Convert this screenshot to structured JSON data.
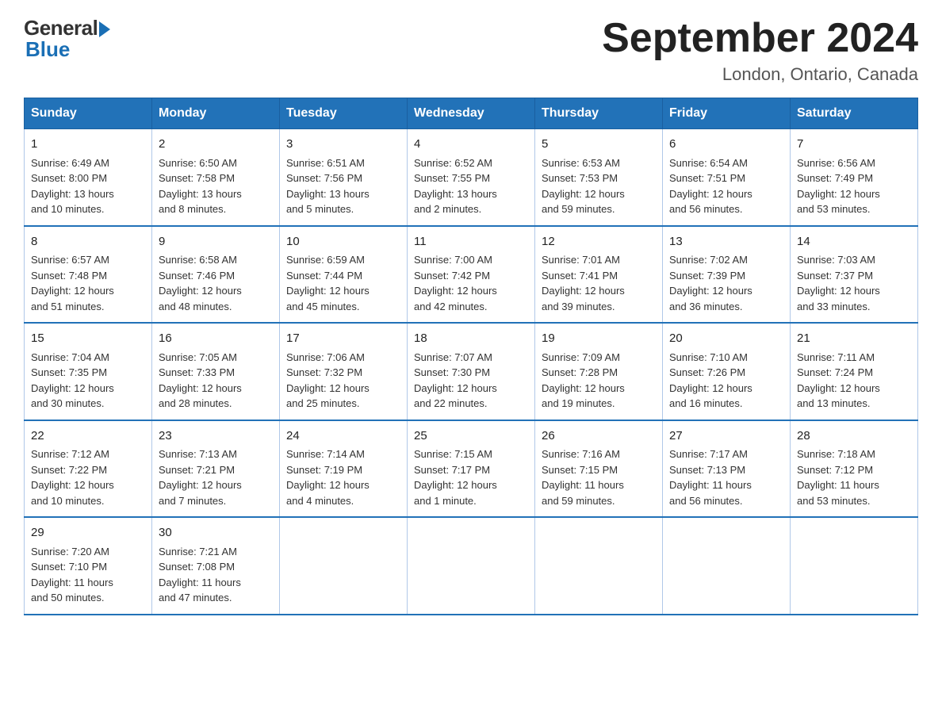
{
  "logo": {
    "general": "General",
    "blue": "Blue"
  },
  "calendar": {
    "title": "September 2024",
    "subtitle": "London, Ontario, Canada"
  },
  "headers": [
    "Sunday",
    "Monday",
    "Tuesday",
    "Wednesday",
    "Thursday",
    "Friday",
    "Saturday"
  ],
  "weeks": [
    [
      {
        "day": "1",
        "info": "Sunrise: 6:49 AM\nSunset: 8:00 PM\nDaylight: 13 hours\nand 10 minutes."
      },
      {
        "day": "2",
        "info": "Sunrise: 6:50 AM\nSunset: 7:58 PM\nDaylight: 13 hours\nand 8 minutes."
      },
      {
        "day": "3",
        "info": "Sunrise: 6:51 AM\nSunset: 7:56 PM\nDaylight: 13 hours\nand 5 minutes."
      },
      {
        "day": "4",
        "info": "Sunrise: 6:52 AM\nSunset: 7:55 PM\nDaylight: 13 hours\nand 2 minutes."
      },
      {
        "day": "5",
        "info": "Sunrise: 6:53 AM\nSunset: 7:53 PM\nDaylight: 12 hours\nand 59 minutes."
      },
      {
        "day": "6",
        "info": "Sunrise: 6:54 AM\nSunset: 7:51 PM\nDaylight: 12 hours\nand 56 minutes."
      },
      {
        "day": "7",
        "info": "Sunrise: 6:56 AM\nSunset: 7:49 PM\nDaylight: 12 hours\nand 53 minutes."
      }
    ],
    [
      {
        "day": "8",
        "info": "Sunrise: 6:57 AM\nSunset: 7:48 PM\nDaylight: 12 hours\nand 51 minutes."
      },
      {
        "day": "9",
        "info": "Sunrise: 6:58 AM\nSunset: 7:46 PM\nDaylight: 12 hours\nand 48 minutes."
      },
      {
        "day": "10",
        "info": "Sunrise: 6:59 AM\nSunset: 7:44 PM\nDaylight: 12 hours\nand 45 minutes."
      },
      {
        "day": "11",
        "info": "Sunrise: 7:00 AM\nSunset: 7:42 PM\nDaylight: 12 hours\nand 42 minutes."
      },
      {
        "day": "12",
        "info": "Sunrise: 7:01 AM\nSunset: 7:41 PM\nDaylight: 12 hours\nand 39 minutes."
      },
      {
        "day": "13",
        "info": "Sunrise: 7:02 AM\nSunset: 7:39 PM\nDaylight: 12 hours\nand 36 minutes."
      },
      {
        "day": "14",
        "info": "Sunrise: 7:03 AM\nSunset: 7:37 PM\nDaylight: 12 hours\nand 33 minutes."
      }
    ],
    [
      {
        "day": "15",
        "info": "Sunrise: 7:04 AM\nSunset: 7:35 PM\nDaylight: 12 hours\nand 30 minutes."
      },
      {
        "day": "16",
        "info": "Sunrise: 7:05 AM\nSunset: 7:33 PM\nDaylight: 12 hours\nand 28 minutes."
      },
      {
        "day": "17",
        "info": "Sunrise: 7:06 AM\nSunset: 7:32 PM\nDaylight: 12 hours\nand 25 minutes."
      },
      {
        "day": "18",
        "info": "Sunrise: 7:07 AM\nSunset: 7:30 PM\nDaylight: 12 hours\nand 22 minutes."
      },
      {
        "day": "19",
        "info": "Sunrise: 7:09 AM\nSunset: 7:28 PM\nDaylight: 12 hours\nand 19 minutes."
      },
      {
        "day": "20",
        "info": "Sunrise: 7:10 AM\nSunset: 7:26 PM\nDaylight: 12 hours\nand 16 minutes."
      },
      {
        "day": "21",
        "info": "Sunrise: 7:11 AM\nSunset: 7:24 PM\nDaylight: 12 hours\nand 13 minutes."
      }
    ],
    [
      {
        "day": "22",
        "info": "Sunrise: 7:12 AM\nSunset: 7:22 PM\nDaylight: 12 hours\nand 10 minutes."
      },
      {
        "day": "23",
        "info": "Sunrise: 7:13 AM\nSunset: 7:21 PM\nDaylight: 12 hours\nand 7 minutes."
      },
      {
        "day": "24",
        "info": "Sunrise: 7:14 AM\nSunset: 7:19 PM\nDaylight: 12 hours\nand 4 minutes."
      },
      {
        "day": "25",
        "info": "Sunrise: 7:15 AM\nSunset: 7:17 PM\nDaylight: 12 hours\nand 1 minute."
      },
      {
        "day": "26",
        "info": "Sunrise: 7:16 AM\nSunset: 7:15 PM\nDaylight: 11 hours\nand 59 minutes."
      },
      {
        "day": "27",
        "info": "Sunrise: 7:17 AM\nSunset: 7:13 PM\nDaylight: 11 hours\nand 56 minutes."
      },
      {
        "day": "28",
        "info": "Sunrise: 7:18 AM\nSunset: 7:12 PM\nDaylight: 11 hours\nand 53 minutes."
      }
    ],
    [
      {
        "day": "29",
        "info": "Sunrise: 7:20 AM\nSunset: 7:10 PM\nDaylight: 11 hours\nand 50 minutes."
      },
      {
        "day": "30",
        "info": "Sunrise: 7:21 AM\nSunset: 7:08 PM\nDaylight: 11 hours\nand 47 minutes."
      },
      {
        "day": "",
        "info": ""
      },
      {
        "day": "",
        "info": ""
      },
      {
        "day": "",
        "info": ""
      },
      {
        "day": "",
        "info": ""
      },
      {
        "day": "",
        "info": ""
      }
    ]
  ]
}
